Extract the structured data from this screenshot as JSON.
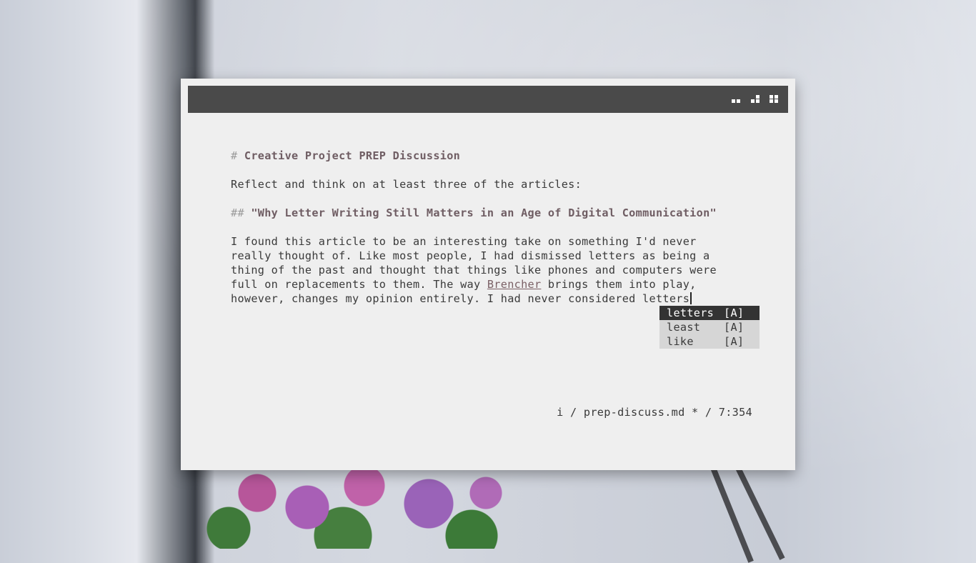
{
  "window": {
    "titlebar_buttons": [
      {
        "icon": "tile-half-icon"
      },
      {
        "icon": "tile-quarter-icon"
      },
      {
        "icon": "tile-full-icon"
      }
    ]
  },
  "document": {
    "h1_marker": "#",
    "h1_text": "Creative Project PREP Discussion",
    "intro": "Reflect and think on at least three of the articles:",
    "h2_marker": "##",
    "h2_text": "\"Why Letter Writing Still Matters in an Age of Digital Communication\"",
    "para_line1": "I found this article to be an interesting take on something I'd never",
    "para_line2": "really thought of. Like most people, I had dismissed letters as being a",
    "para_line3": "thing of the past and thought that things like phones and computers were",
    "para_line4_a": "full on replacements to them. The way ",
    "para_line4_link": "Brencher",
    "para_line4_b": " brings them into play,",
    "para_line5": "however, changes my opinion entirely. I had never considered letters"
  },
  "autocomplete": {
    "items": [
      {
        "word": "letters",
        "tag": "[A]",
        "selected": true
      },
      {
        "word": "least",
        "tag": "[A]",
        "selected": false
      },
      {
        "word": "like",
        "tag": "[A]",
        "selected": false
      }
    ]
  },
  "status": {
    "text": "i / prep-discuss.md * / 7:354"
  },
  "colors": {
    "titlebar": "#4a4a4a",
    "editor_bg": "#efefef",
    "heading": "#6f5d63",
    "selection": "#333333"
  }
}
